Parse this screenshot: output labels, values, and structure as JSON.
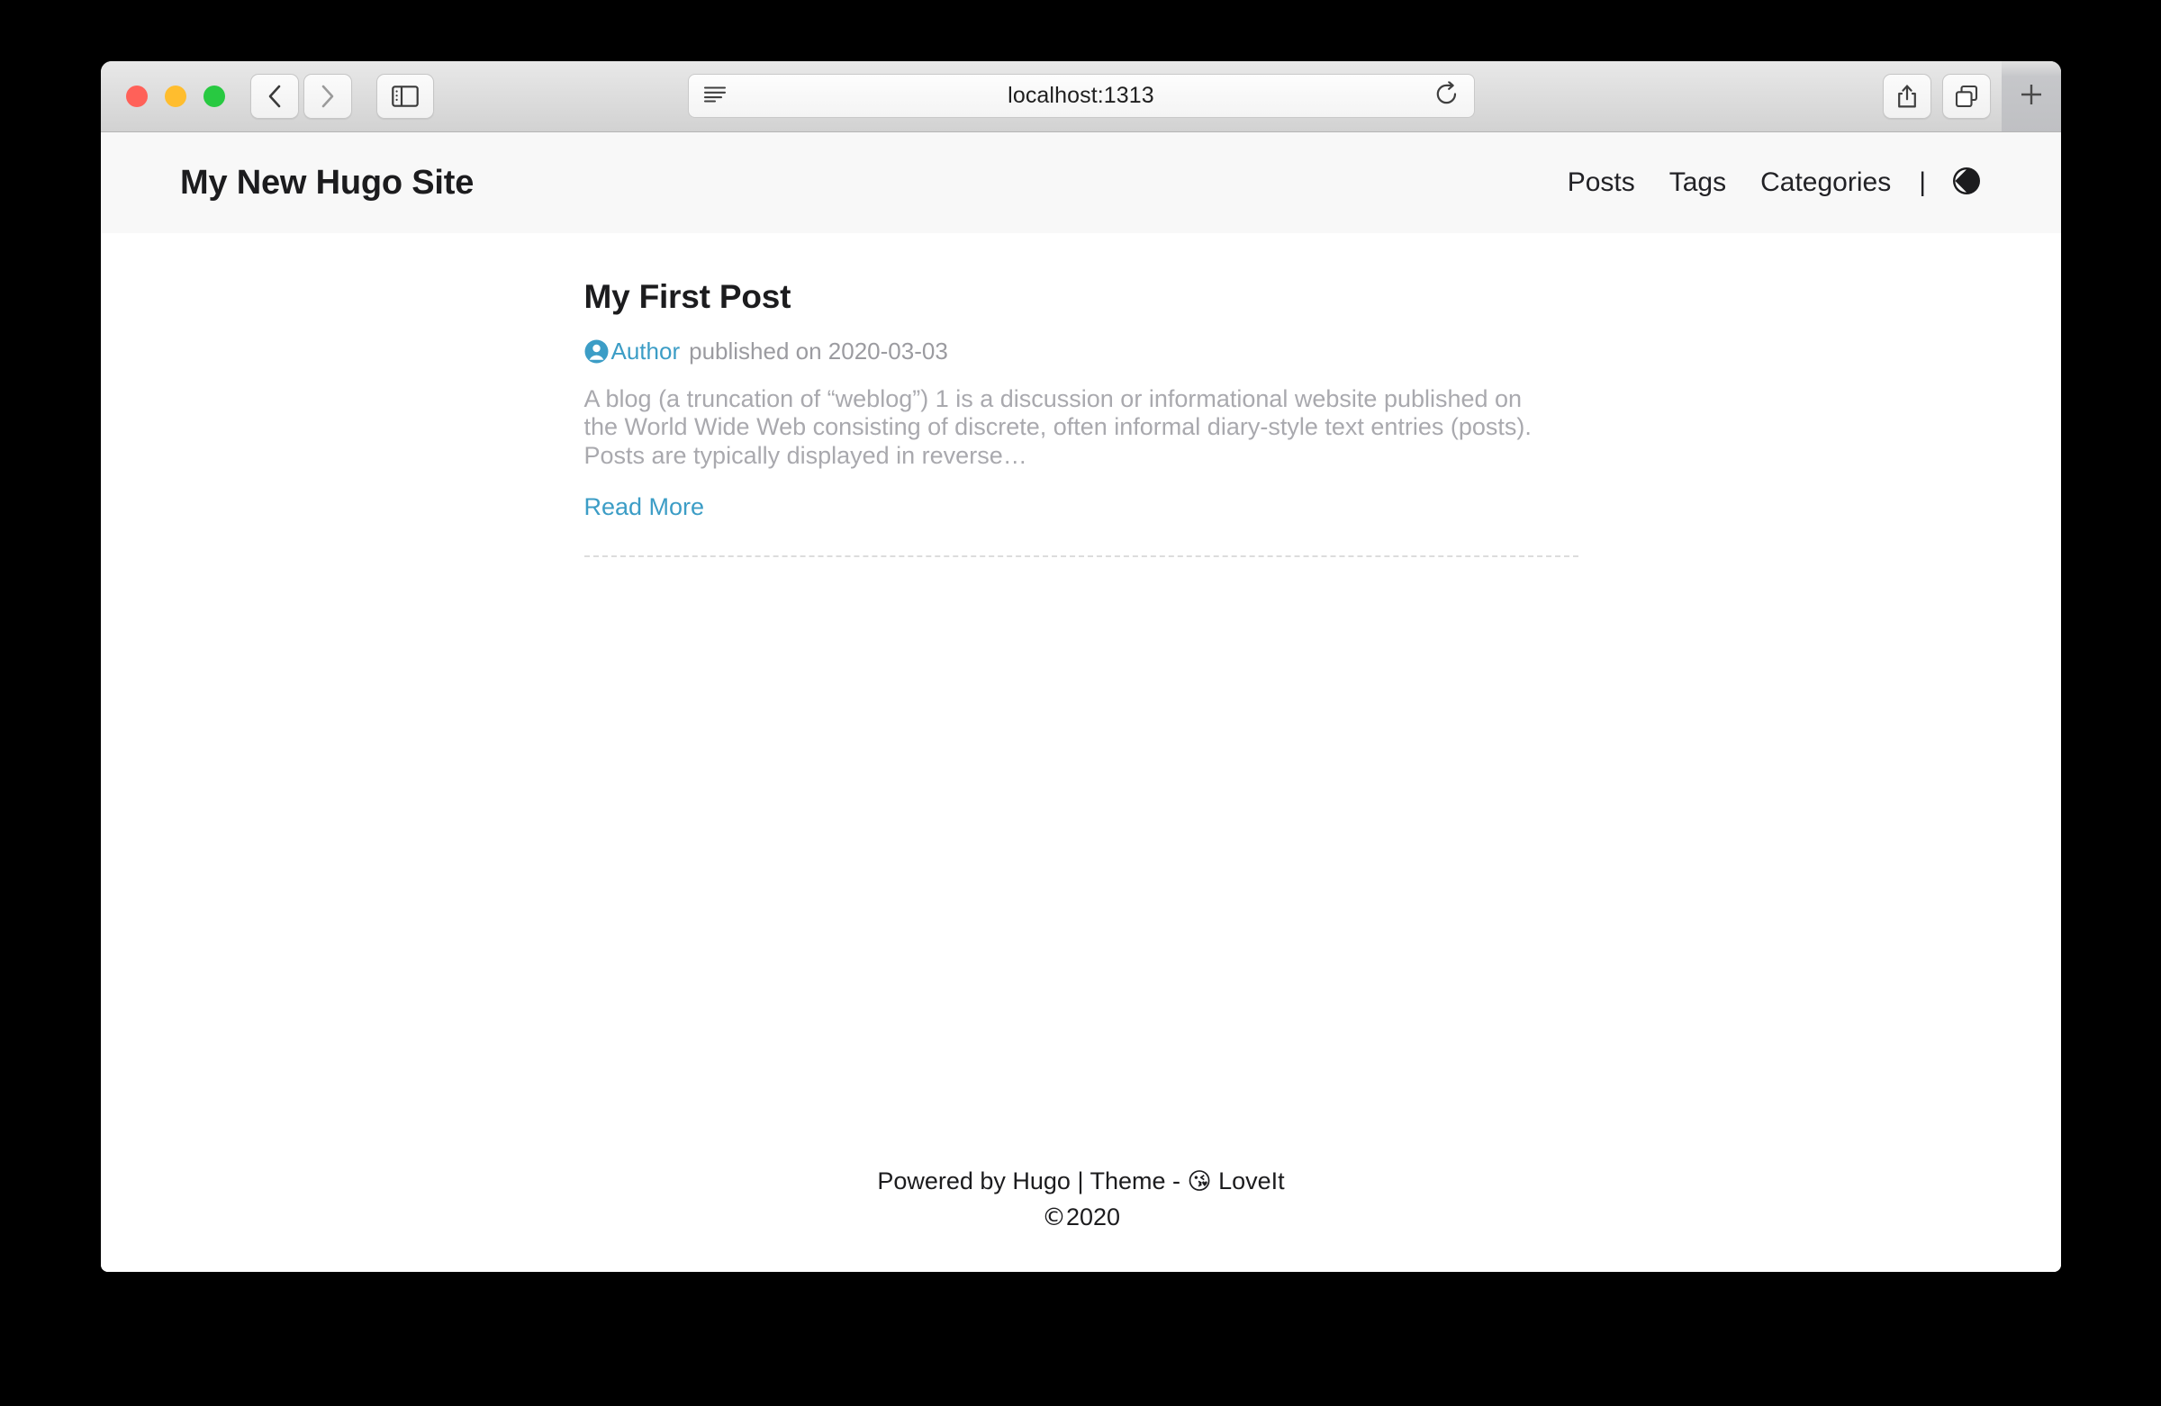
{
  "browser": {
    "traffic_lights": [
      {
        "name": "close",
        "color": "#ff6159"
      },
      {
        "name": "minimize",
        "color": "#ffbd2e"
      },
      {
        "name": "maximize",
        "color": "#28c941"
      }
    ],
    "back_label": "Back",
    "forward_label": "Forward",
    "sidebar_label": "Show Sidebar",
    "reader_label": "Reader View",
    "reload_label": "Reload",
    "share_label": "Share",
    "tabs_overview_label": "Show Tab Overview",
    "new_tab_label": "+",
    "url": "localhost:1313"
  },
  "site": {
    "title": "My New Hugo Site",
    "nav": [
      {
        "label": "Posts"
      },
      {
        "label": "Tags"
      },
      {
        "label": "Categories"
      }
    ],
    "nav_separator": "|",
    "theme_toggle_label": "Switch Theme"
  },
  "post": {
    "title": "My First Post",
    "author": "Author",
    "published_text": "published on 2020-03-03",
    "excerpt": "A blog (a truncation of “weblog”) 1 is a discussion or informational website published on the World Wide Web consisting of discrete, often informal diary-style text entries (posts). Posts are typically displayed in reverse…",
    "read_more": "Read More"
  },
  "footer": {
    "powered_by": "Powered by Hugo | Theme - ",
    "theme_emoji": "😘",
    "theme_name": " LoveIt",
    "copyright_glyph": "©",
    "copyright_year": "2020"
  },
  "colors": {
    "accent": "#3c9dc6",
    "header_bg": "#f8f8f8",
    "text": "#1c1c1e",
    "muted": "#a9a9ae"
  }
}
